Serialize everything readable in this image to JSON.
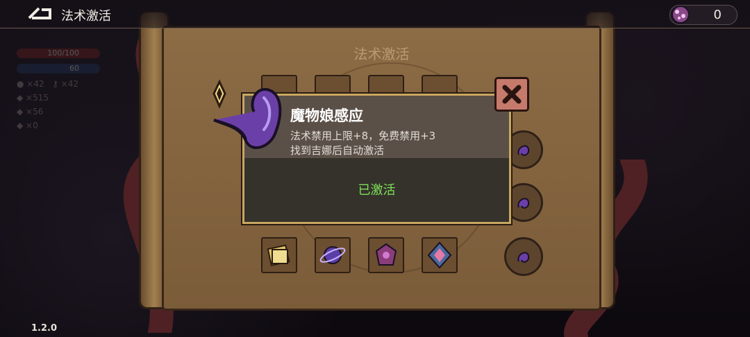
{
  "header": {
    "title": "法术激活",
    "gem_count": "0"
  },
  "hud": {
    "hp": "100/100",
    "mp": "60",
    "gold": "×42",
    "keys": "×42",
    "items_a": "×515",
    "items_b": "×56",
    "items_c": "×0"
  },
  "panel": {
    "title": "法术激活"
  },
  "popup": {
    "name": "魔物娘感应",
    "desc_line1": "法术禁用上限+8，免费禁用+3",
    "desc_line2": "找到吉娜后自动激活",
    "status": "已激活",
    "status_color": "#7ee25a"
  },
  "version": "1.2.0",
  "icons": [
    "back-icon",
    "gem-icon",
    "close-icon",
    "tentacle-spell-icon",
    "scroll-spell-icon",
    "planet-spell-icon",
    "crystal-spell-icon",
    "rune-spell-icon"
  ]
}
